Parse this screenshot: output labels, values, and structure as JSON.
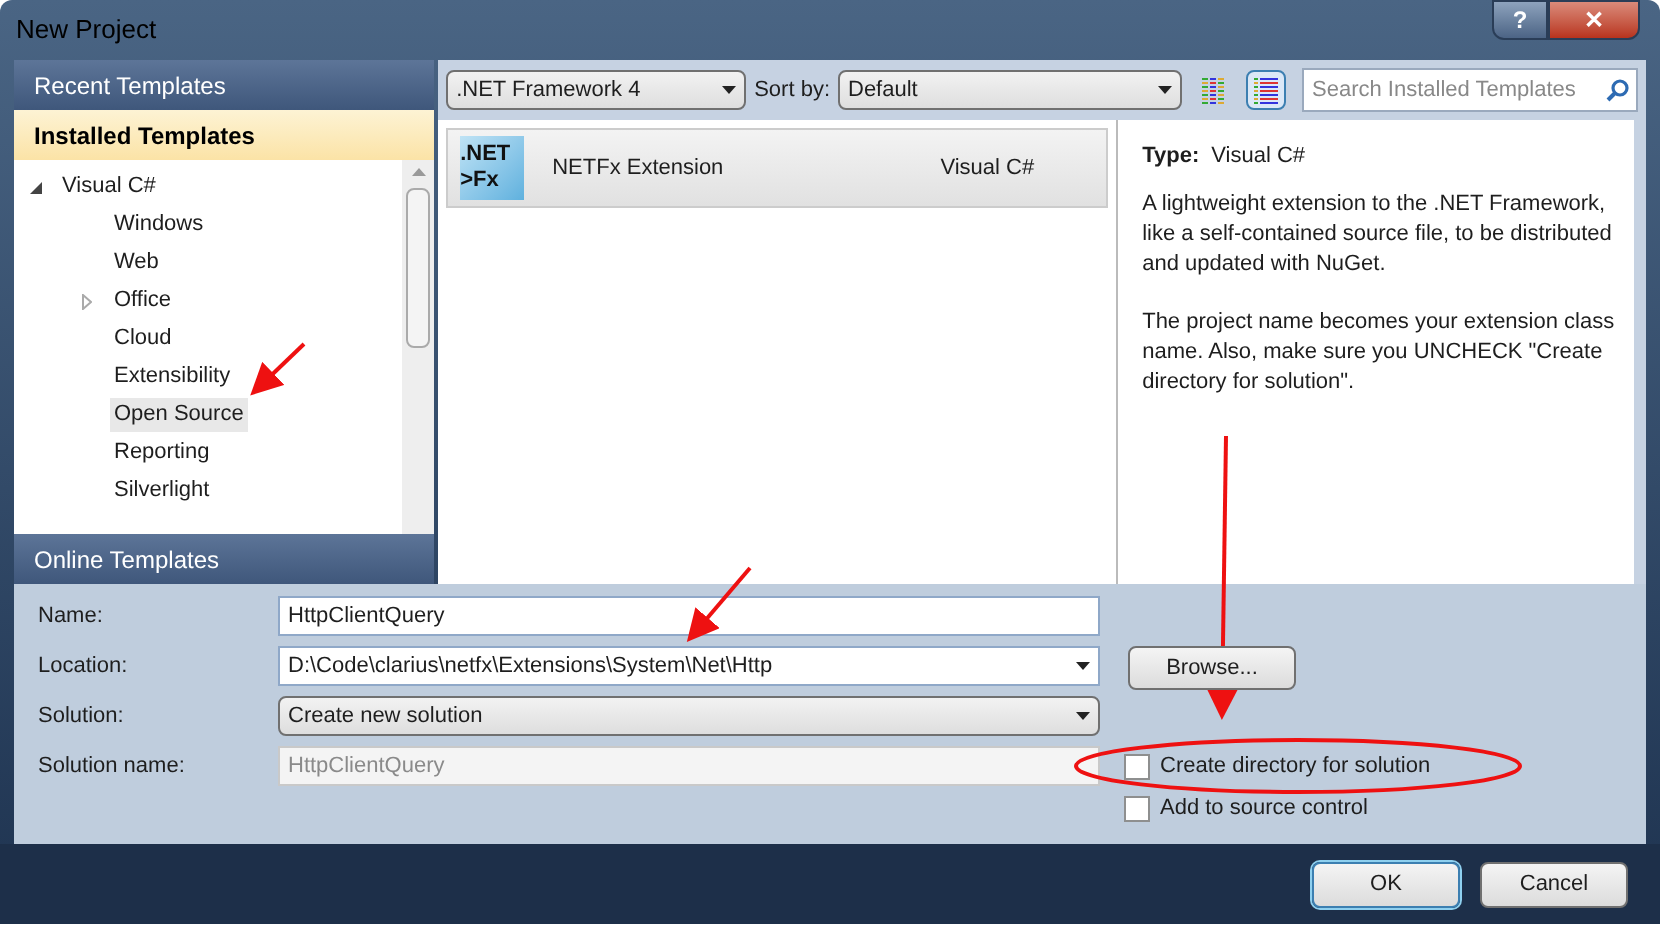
{
  "window": {
    "title": "New Project",
    "buttons": [
      "?",
      "✕"
    ]
  },
  "sections": [
    {
      "label": "Recent Templates",
      "selected": false
    },
    {
      "label": "Installed Templates",
      "selected": true
    }
  ],
  "tree": [
    {
      "label": "Visual C#",
      "kind": "branch",
      "expanded": true,
      "selected": false,
      "children": [
        {
          "label": "Windows",
          "kind": "leaf",
          "selected": false
        },
        {
          "label": "Web",
          "kind": "leaf",
          "selected": false
        },
        {
          "label": "Office",
          "kind": "branch",
          "expanded": false,
          "selected": false
        },
        {
          "label": "Cloud",
          "kind": "leaf",
          "selected": false
        },
        {
          "label": "Extensibility",
          "kind": "leaf",
          "selected": false
        },
        {
          "label": "Open Source",
          "kind": "leaf",
          "selected": true
        },
        {
          "label": "Reporting",
          "kind": "leaf",
          "selected": false
        },
        {
          "label": "Silverlight",
          "kind": "leaf",
          "selected": false
        }
      ]
    }
  ],
  "online_section": {
    "label": "Online Templates",
    "selected": false
  },
  "toolbar": {
    "framework": ".NET Framework 4",
    "sort_label": "Sort by:",
    "sort": "Default",
    "views": [
      {
        "kind": "medium",
        "selected": false
      },
      {
        "kind": "small",
        "selected": true
      }
    ],
    "search": {
      "placeholder": "Search Installed Templates"
    }
  },
  "templates": [
    {
      "icon_line_1": ".NET",
      "icon_line_2": ">Fx",
      "name": "NETFx Extension",
      "language": "Visual C#",
      "selected": true
    }
  ],
  "details": {
    "type_label": "Type:",
    "type": "Visual C#",
    "paragraphs": [
      "A lightweight extension to the .NET Framework, like a self-contained source file, to be distributed and updated with NuGet.",
      "The project name becomes your extension class name. Also, make sure you UNCHECK \"Create directory for solution\"."
    ]
  },
  "form": {
    "rows": [
      {
        "label": "Name:",
        "kind": "text",
        "value": "HttpClientQuery",
        "disabled": false
      },
      {
        "label": "Location:",
        "kind": "combo",
        "value": "D:\\Code\\clarius\\netfx\\Extensions\\System\\Net\\Http",
        "disabled": false
      },
      {
        "label": "Solution:",
        "kind": "dropdown",
        "value": "Create new solution",
        "disabled": false
      },
      {
        "label": "Solution name:",
        "kind": "text",
        "value": "HttpClientQuery",
        "disabled": true
      }
    ],
    "browse": "Browse...",
    "checkboxes": [
      {
        "label": "Create directory for solution",
        "checked": false
      },
      {
        "label": "Add to source control",
        "checked": false
      }
    ]
  },
  "buttons": [
    {
      "label": "OK",
      "default": true
    },
    {
      "label": "Cancel",
      "default": false
    }
  ]
}
